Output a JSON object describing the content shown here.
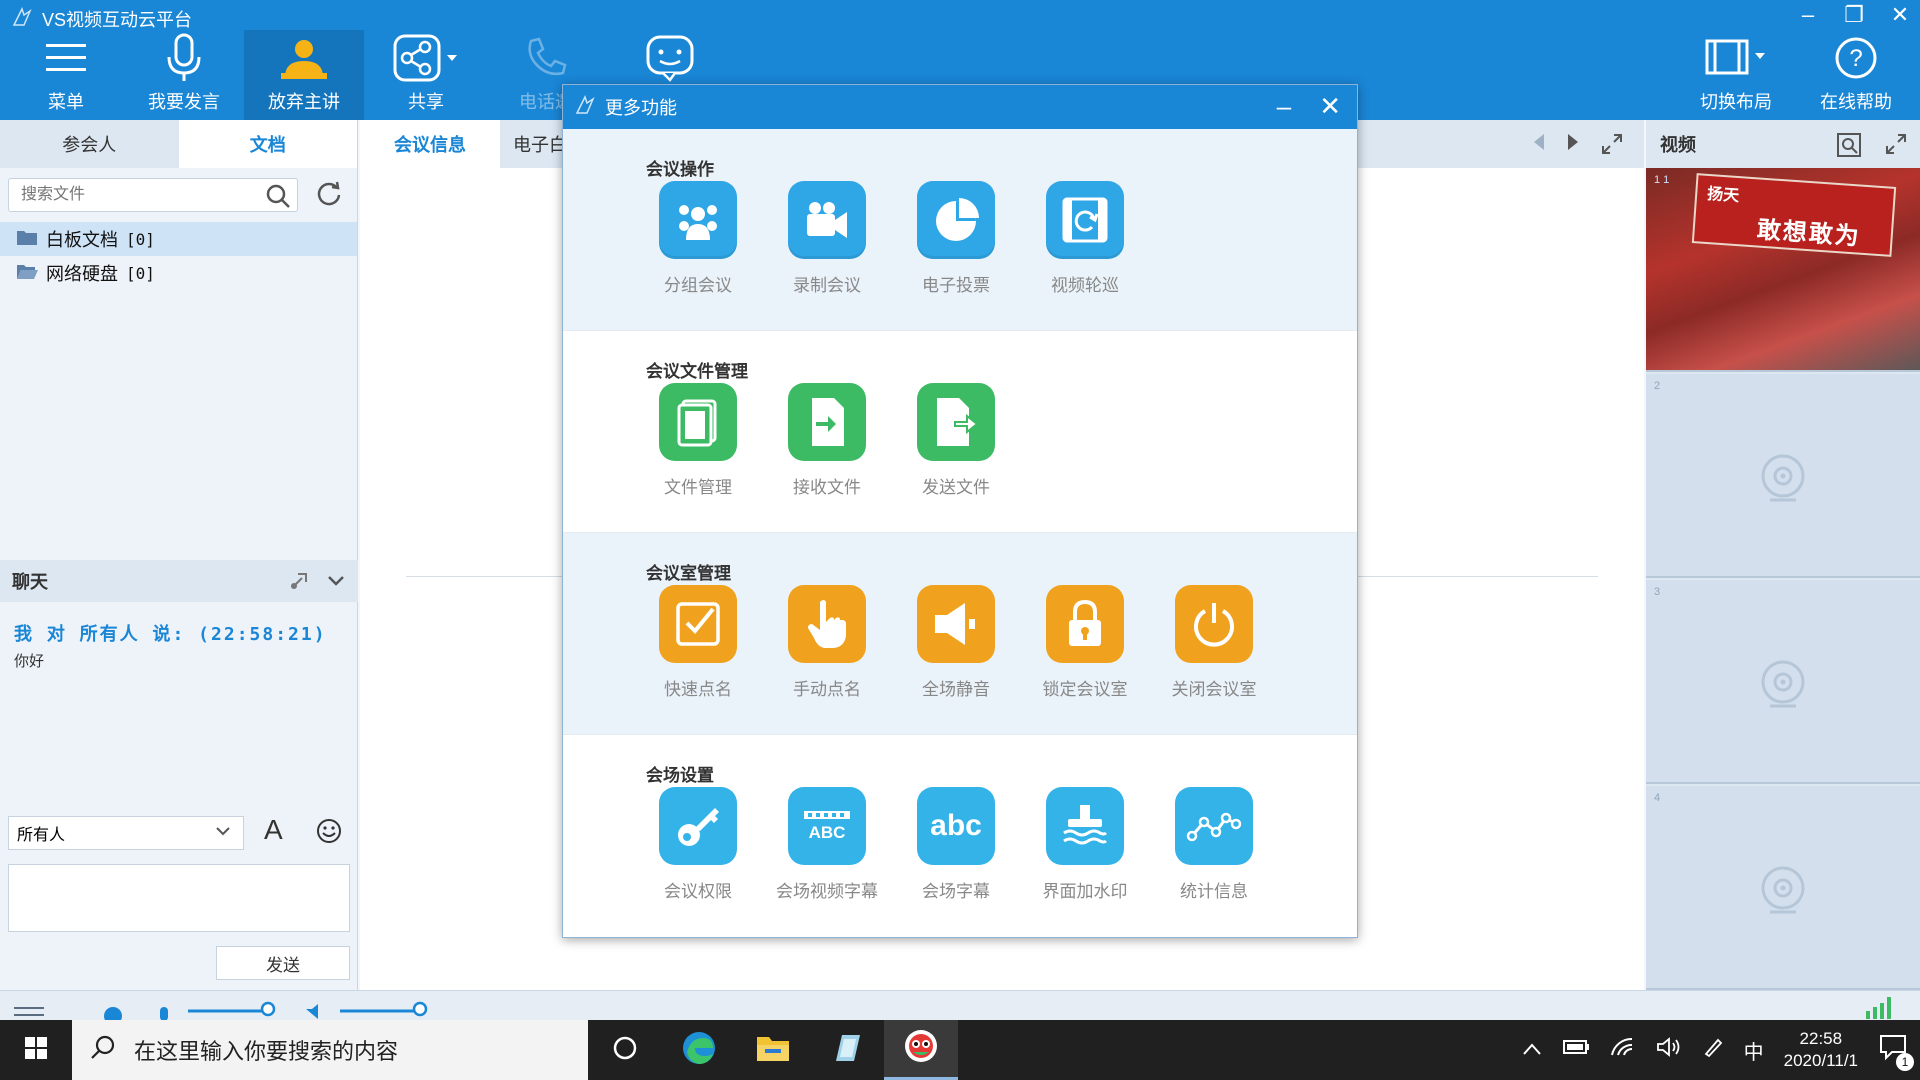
{
  "app": {
    "title": "VS视频互动云平台",
    "window_controls": [
      "–",
      "❐",
      "✕"
    ]
  },
  "toolbar": {
    "menu": "菜单",
    "speak": "我要发言",
    "give_up": "放弃主讲",
    "share": "共享",
    "phone": "电话邀",
    "more": "",
    "layout": "切换布局",
    "help": "在线帮助"
  },
  "left": {
    "tabs": [
      "参会人",
      "文档"
    ],
    "search_placeholder": "搜索文件",
    "tree": [
      {
        "label": "白板文档",
        "count": "[0]"
      },
      {
        "label": "网络硬盘",
        "count": "[0]"
      }
    ],
    "chat": {
      "title": "聊天",
      "from_line": "我 对 所有人 说:  (22:58:21)",
      "message": "你好",
      "recipient": "所有人",
      "send": "发送"
    }
  },
  "center": {
    "tabs": [
      "会议信息",
      "电子白"
    ]
  },
  "right": {
    "title": "视频",
    "cells": [
      {
        "num": "1 1",
        "sign_small": "扬天",
        "sign_big": "敢想敢为"
      },
      {
        "num": "2"
      },
      {
        "num": "3"
      },
      {
        "num": "4"
      }
    ]
  },
  "modal": {
    "title": "更多功能",
    "sections": [
      {
        "title": "会议操作",
        "items": [
          "分组会议",
          "录制会议",
          "电子投票",
          "视频轮巡"
        ]
      },
      {
        "title": "会议文件管理",
        "items": [
          "文件管理",
          "接收文件",
          "发送文件"
        ]
      },
      {
        "title": "会议室管理",
        "items": [
          "快速点名",
          "手动点名",
          "全场静音",
          "锁定会议室",
          "关闭会议室"
        ]
      },
      {
        "title": "会场设置",
        "items": [
          "会议权限",
          "会场视频字幕",
          "会场字幕",
          "界面加水印",
          "统计信息"
        ]
      }
    ],
    "tile_text": {
      "abc_caption": "ABC",
      "abc": "abc"
    }
  },
  "taskbar": {
    "search_placeholder": "在这里输入你要搜索的内容",
    "ime": "中",
    "time": "22:58",
    "date": "2020/11/1",
    "notif_count": "1"
  },
  "colors": {
    "brand_blue": "#1a86d6",
    "tile_blue": "#2fa6e6",
    "tile_green": "#3dbb64",
    "tile_orange": "#f0a21f"
  }
}
